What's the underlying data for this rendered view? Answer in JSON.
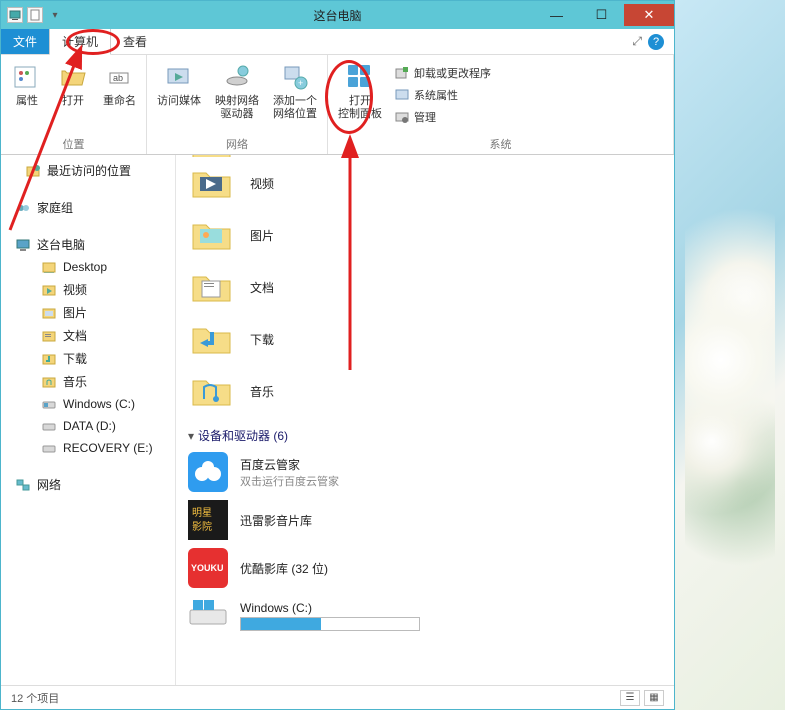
{
  "titlebar": {
    "title": "这台电脑"
  },
  "menu": {
    "file": "文件",
    "computer": "计算机",
    "view": "查看"
  },
  "ribbon": {
    "group_location": "位置",
    "group_network": "网络",
    "group_system": "系统",
    "properties": "属性",
    "open": "打开",
    "rename": "重命名",
    "access_media": "访问媒体",
    "map_drive": "映射网络\n驱动器",
    "add_network": "添加一个\n网络位置",
    "open_ctrl": "打开\n控制面板",
    "uninstall": "卸载或更改程序",
    "sys_props": "系统属性",
    "manage": "管理"
  },
  "sidebar": {
    "recent": "最近访问的位置",
    "homegroup": "家庭组",
    "thispc": "这台电脑",
    "items": [
      {
        "label": "Desktop"
      },
      {
        "label": "视频"
      },
      {
        "label": "图片"
      },
      {
        "label": "文档"
      },
      {
        "label": "下载"
      },
      {
        "label": "音乐"
      },
      {
        "label": "Windows (C:)"
      },
      {
        "label": "DATA (D:)"
      },
      {
        "label": "RECOVERY (E:)"
      }
    ],
    "network": "网络"
  },
  "content": {
    "folders": [
      {
        "label": "视频"
      },
      {
        "label": "图片"
      },
      {
        "label": "文档"
      },
      {
        "label": "下载"
      },
      {
        "label": "音乐"
      }
    ],
    "devices_header": "设备和驱动器 (6)",
    "devices": [
      {
        "name": "百度云管家",
        "sub": "双击运行百度云管家",
        "kind": "baidu"
      },
      {
        "name": "迅雷影音片库",
        "sub": "",
        "kind": "xunlei"
      },
      {
        "name": "优酷影库 (32 位)",
        "sub": "",
        "kind": "youku"
      },
      {
        "name": "Windows (C:)",
        "sub": "",
        "kind": "drive",
        "progress": 45
      }
    ]
  },
  "status": {
    "count": "12 个项目"
  },
  "colors": {
    "accent": "#1e8fd4",
    "titlebar": "#5ec7d6",
    "close": "#c74634",
    "annot": "#e02020"
  }
}
